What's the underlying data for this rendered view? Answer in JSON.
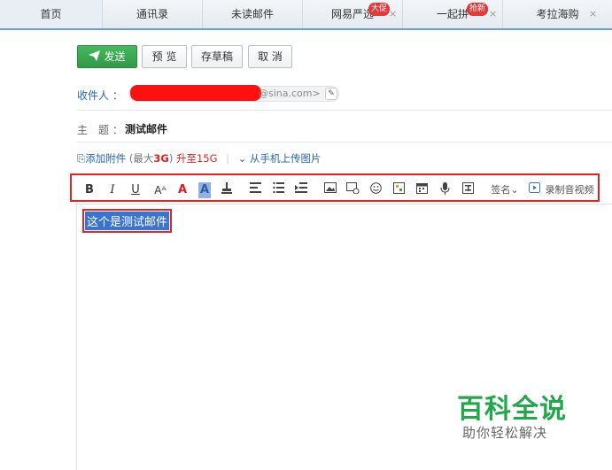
{
  "tabs": [
    {
      "label": "首页",
      "badge": "",
      "closable": false
    },
    {
      "label": "通讯录",
      "badge": "",
      "closable": false
    },
    {
      "label": "未读邮件",
      "badge": "",
      "closable": false
    },
    {
      "label": "网易严选",
      "badge": "大促",
      "closable": true
    },
    {
      "label": "一起拼",
      "badge": "抢新",
      "closable": true
    },
    {
      "label": "考拉海购",
      "badge": "",
      "closable": true
    }
  ],
  "close_glyph": "×",
  "actions": {
    "send_label": "发送",
    "preview_label": "预 览",
    "draft_label": "存草稿",
    "cancel_label": "取 消"
  },
  "recipient": {
    "label": "收件人 ：",
    "domain": "@sina.com>"
  },
  "subject": {
    "label": "主　题 ：",
    "value": "测试邮件"
  },
  "attachment": {
    "add_label": "添加附件",
    "max_prefix": "(最大",
    "max_size": "3G",
    "max_suffix": ")",
    "upgrade": "升至15G",
    "mobile_upload": "从手机上传图片"
  },
  "toolbar": {
    "bold": "B",
    "italic": "I",
    "underline": "U",
    "font_size": "Aᴬ",
    "font_color": "A",
    "bg_color": "A",
    "signature": "签名",
    "record": "录制音视频"
  },
  "editor": {
    "body_text": "这个是测试邮件"
  },
  "watermark": {
    "title": "百科全说",
    "subtitle": "助你轻松解决"
  },
  "colors": {
    "accent_green": "#2f9a46",
    "highlight_red": "#e02525",
    "selection_blue": "#3a74d1",
    "link_blue": "#2765b0"
  }
}
